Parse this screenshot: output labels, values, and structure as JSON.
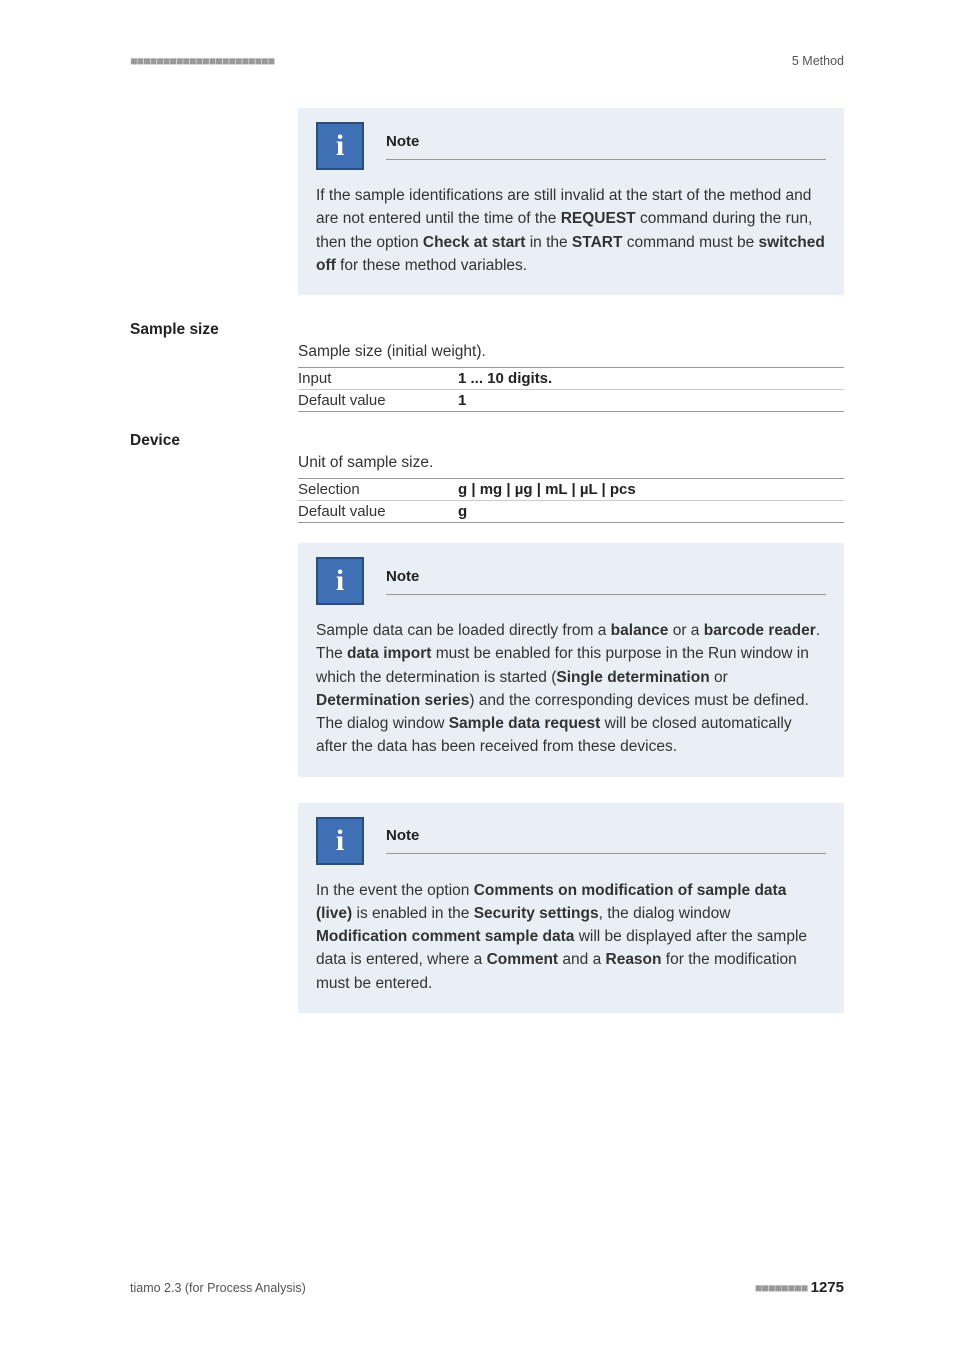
{
  "header": {
    "left_marks": "■■■■■■■■■■■■■■■■■■■■■■",
    "right": "5 Method"
  },
  "note1": {
    "title": "Note",
    "body_pre": "If the sample identifications are still invalid at the start of the method and are not entered until the time of the ",
    "b1": "REQUEST",
    "mid1": " command during the run, then the option ",
    "b2": "Check at start",
    "mid2": " in the ",
    "b3": "START",
    "mid3": " command must be ",
    "b4": "switched off",
    "end": " for these method variables."
  },
  "sample_size": {
    "label": "Sample size",
    "desc": "Sample size (initial weight).",
    "input_key": "Input",
    "input_val": "1 ... 10 digits.",
    "default_key": "Default value",
    "default_val": "1"
  },
  "device": {
    "label": "Device",
    "desc": "Unit of sample size.",
    "sel_key": "Selection",
    "sel_val": "g | mg | µg | mL | µL | pcs",
    "default_key": "Default value",
    "default_val": "g"
  },
  "note2": {
    "title": "Note",
    "t1": "Sample data can be loaded directly from a ",
    "b1": "balance",
    "t2": " or a ",
    "b2": "barcode reader",
    "t3": ". The ",
    "b3": "data import",
    "t4": " must be enabled for this purpose in the Run window in which the determination is started (",
    "b4": "Single determination",
    "t5": " or ",
    "b5": "Determination series",
    "t6": ") and the corresponding devices must be defined. The dialog window ",
    "b6": "Sample data request",
    "t7": " will be closed automatically after the data has been received from these devices."
  },
  "note3": {
    "title": "Note",
    "t1": "In the event the option ",
    "b1": "Comments on modification of sample data (live)",
    "t2": " is enabled in the ",
    "b2": "Security settings",
    "t3": ", the dialog window ",
    "b3": "Modification comment sample data",
    "t4": " will be displayed after the sample data is entered, where a ",
    "b4": "Comment",
    "t5": " and a ",
    "b5": "Reason",
    "t6": " for the modification must be entered."
  },
  "footer": {
    "left": "tiamo 2.3 (for Process Analysis)",
    "marks": "■■■■■■■■",
    "page": "1275"
  }
}
